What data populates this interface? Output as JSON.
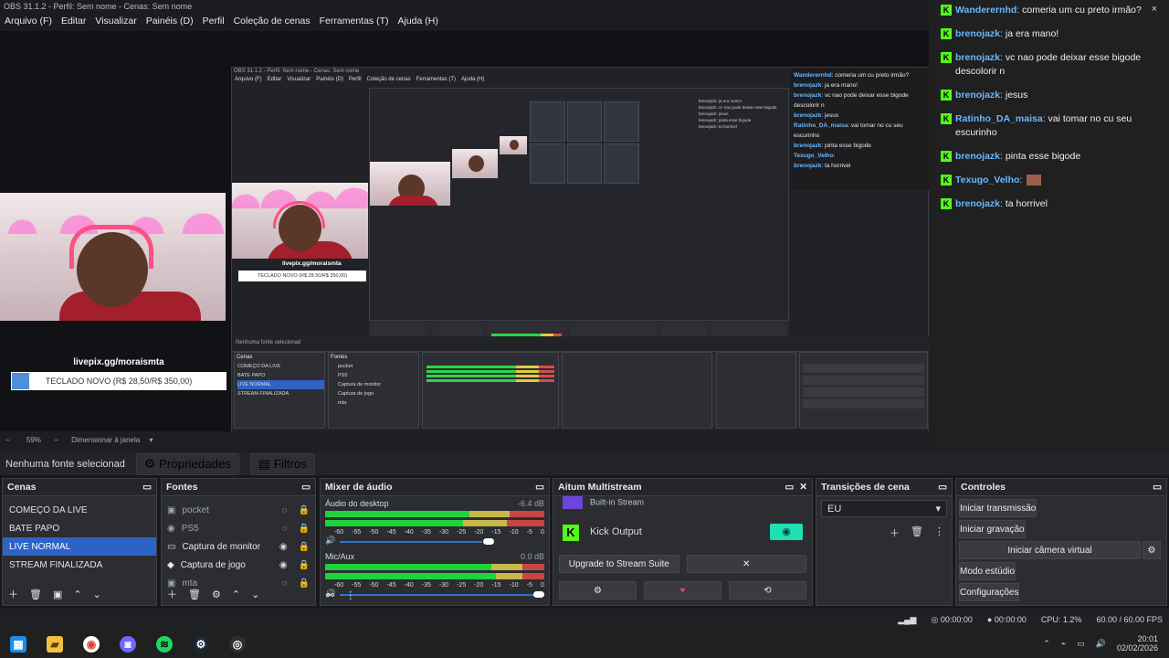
{
  "window": {
    "title": "OBS 31.1.2 - Perfil: Sem nome - Cenas: Sem nome",
    "menu": [
      "Arquivo (F)",
      "Editar",
      "Visualizar",
      "Painéis (D)",
      "Perfil",
      "Coleção de cenas",
      "Ferramentas (T)",
      "Ajuda (H)"
    ]
  },
  "preview": {
    "overlay_url": "livepix.gg/moraismta",
    "goal_text": "TECLADO NOVO (R$ 28,50/R$ 350,00)",
    "goal_progress": 0.0814
  },
  "chat": {
    "close_icon": "×",
    "messages": [
      {
        "user": "Wanderernhd",
        "text": "comeria um cu preto irmão?"
      },
      {
        "user": "brenojazk",
        "text": "ja era mano!"
      },
      {
        "user": "brenojazk",
        "text": "vc nao pode deixar esse bigode descolorir n"
      },
      {
        "user": "brenojazk",
        "text": "jesus"
      },
      {
        "user": "Ratinho_DA_maisa",
        "text": "vai tomar no cu seu escurinho"
      },
      {
        "user": "brenojazk",
        "text": "pinta esse bigode"
      },
      {
        "user": "Texugo_Velho",
        "text": ""
      },
      {
        "user": "brenojazk",
        "text": "ta horrivel"
      }
    ]
  },
  "zoom": {
    "percent": "59%",
    "mode": "Dimensionar à janela"
  },
  "sourcebar": {
    "selected": "Nenhuma fonte selecionad",
    "properties": "Propriedades",
    "filters": "Filtros"
  },
  "scenes": {
    "title": "Cenas",
    "items": [
      "COMEÇO DA LIVE",
      "BATE PAPO",
      "LIVE NORMAL",
      "STREAM FINALIZADA"
    ]
  },
  "sources": {
    "title": "Fontes",
    "items": [
      "pocket",
      "PS5",
      "Captura de monitor",
      "Captura de jogo",
      "mta"
    ]
  },
  "mixer": {
    "title": "Mixer de áudio",
    "channels": [
      {
        "name": "Áudio do desktop",
        "db": "-6.4 dB"
      },
      {
        "name": "Mic/Aux",
        "db": "0.0 dB"
      }
    ],
    "scale": [
      "-60",
      "-55",
      "-50",
      "-45",
      "-40",
      "-35",
      "-30",
      "-25",
      "-20",
      "-15",
      "-10",
      "-5",
      "0"
    ]
  },
  "multistream": {
    "title": "Aitum Multistream",
    "partial_item": "Built-in Stream",
    "kick_output": "Kick Output",
    "upgrade": "Upgrade to Stream Suite"
  },
  "transitions": {
    "title": "Transições de cena",
    "selected": "EU"
  },
  "controls": {
    "title": "Controles",
    "buttons": [
      "Iniciar transmissão",
      "Iniciar gravação",
      "Iniciar câmera virtual",
      "Modo estúdio",
      "Configurações"
    ]
  },
  "status": {
    "stream_time": "00:00:00",
    "record_time": "00:00:00",
    "cpu": "CPU: 1.2%",
    "fps": "60.00 / 60.00 FPS"
  },
  "taskbar": {
    "time": "20:01",
    "date": "02/02/2026"
  }
}
